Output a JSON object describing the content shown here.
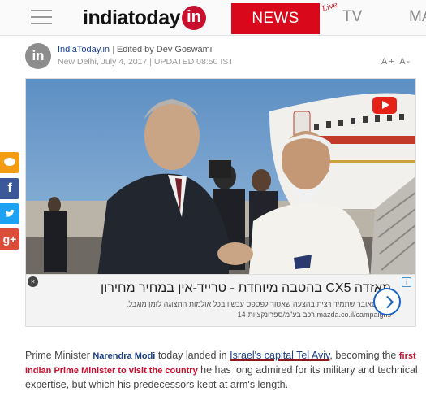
{
  "header": {
    "logo_text": "indiatoday",
    "logo_badge": "in",
    "nav": {
      "news": "NEWS",
      "live": "Live",
      "tv": "TV",
      "next": "MA"
    }
  },
  "byline": {
    "avatar_text": "in",
    "source": "IndiaToday.in",
    "separator": "|",
    "editor": "Edited by Dev Goswami",
    "dateline": "New Delhi, July 4, 2017 | UPDATED 08:50 IST",
    "font_controls": "A+ A-"
  },
  "media": {
    "play_icon": "youtube-play-icon"
  },
  "ad": {
    "close_label": "×",
    "info_label": "i",
    "headline": "מאזדה CX5 בהטבה מיוחדת - טרייד-אין במחיר מחירון",
    "subtext": "הקרוסאובר שתמיד רצית בהצעה שאסור לפספס עכשיו בכל אולמות התצוגה לזמן מוגבל.",
    "url": "14-רכב בע\"מ/ספרונקציות.mazda.co.il/campaigns"
  },
  "share": {
    "comment": "comment-icon",
    "facebook": "f",
    "twitter": "twitter-icon",
    "google": "g+"
  },
  "article": {
    "p1": "Prime Minister ",
    "name": "Narendra Modi",
    "p2": " today landed in ",
    "link": "Israel's capital Tel Aviv",
    "p3": ", becoming the ",
    "red": "first Indian Prime Minister to visit the country",
    "p4": " he has long admired for its military and technical expertise, but which his predecessors kept at arm's length."
  },
  "colors": {
    "brand_red": "#d9091b",
    "link_blue": "#1b3f8b",
    "facebook": "#3b5998",
    "twitter": "#1da1f2",
    "google": "#dd4b39",
    "comment": "#f39c12"
  }
}
